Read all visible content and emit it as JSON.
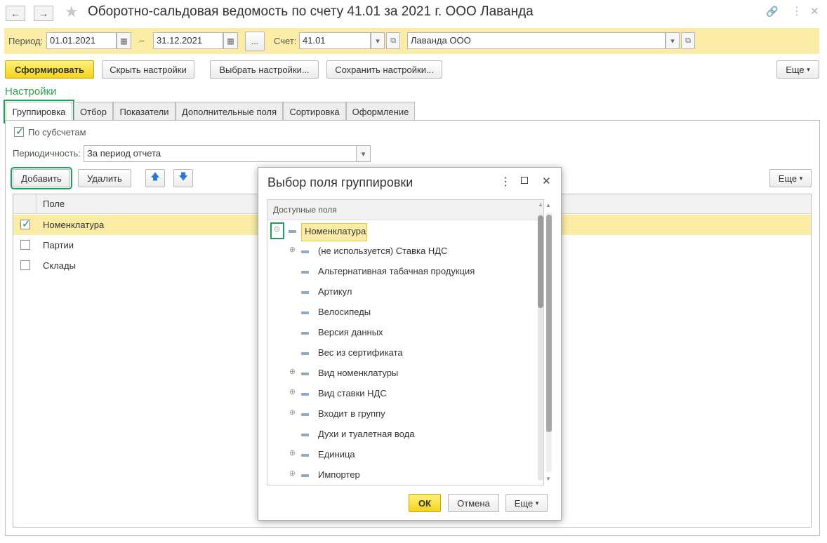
{
  "window": {
    "title": "Оборотно-сальдовая ведомость по счету 41.01 за 2021 г. ООО Лаванда",
    "back_icon": "arrow-left-icon",
    "forward_icon": "arrow-right-icon",
    "star_icon": "star-icon",
    "link_icon": "link-icon",
    "menu_icon": "more-vertical-icon",
    "close_icon": "close-icon"
  },
  "period": {
    "label": "Период:",
    "from": "01.01.2021",
    "dash": "–",
    "to": "31.12.2021",
    "dots_button": "...",
    "account_label": "Счет:",
    "account": "41.01",
    "organization": "Лаванда ООО"
  },
  "toolbar": {
    "generate": "Сформировать",
    "hide_settings": "Скрыть настройки",
    "choose_settings": "Выбрать настройки...",
    "save_settings": "Сохранить настройки...",
    "more": "Еще"
  },
  "settings": {
    "title": "Настройки",
    "tabs": [
      "Группировка",
      "Отбор",
      "Показатели",
      "Дополнительные поля",
      "Сортировка",
      "Оформление"
    ],
    "by_subaccounts": "По субсчетам",
    "periodicity_label": "Периодичность:",
    "periodicity_value": "За период отчета",
    "add_button": "Добавить",
    "delete_button": "Удалить",
    "more": "Еще",
    "grid_header": "Поле",
    "rows": [
      {
        "label": "Номенклатура",
        "checked": true
      },
      {
        "label": "Партии",
        "checked": false
      },
      {
        "label": "Склады",
        "checked": false
      }
    ]
  },
  "dialog": {
    "title": "Выбор поля группировки",
    "tree_header": "Доступные поля",
    "root": "Номенклатура",
    "items": [
      {
        "label": "(не используется) Ставка НДС",
        "expandable": true
      },
      {
        "label": "Альтернативная табачная продукция",
        "expandable": false
      },
      {
        "label": "Артикул",
        "expandable": false
      },
      {
        "label": "Велосипеды",
        "expandable": false
      },
      {
        "label": "Версия данных",
        "expandable": false
      },
      {
        "label": "Вес из сертификата",
        "expandable": false
      },
      {
        "label": "Вид номенклатуры",
        "expandable": true
      },
      {
        "label": "Вид ставки НДС",
        "expandable": true
      },
      {
        "label": "Входит в группу",
        "expandable": true
      },
      {
        "label": "Духи и туалетная вода",
        "expandable": false
      },
      {
        "label": "Единица",
        "expandable": true
      },
      {
        "label": "Импортер",
        "expandable": true
      }
    ],
    "ok": "ОК",
    "cancel": "Отмена",
    "more": "Еще"
  }
}
